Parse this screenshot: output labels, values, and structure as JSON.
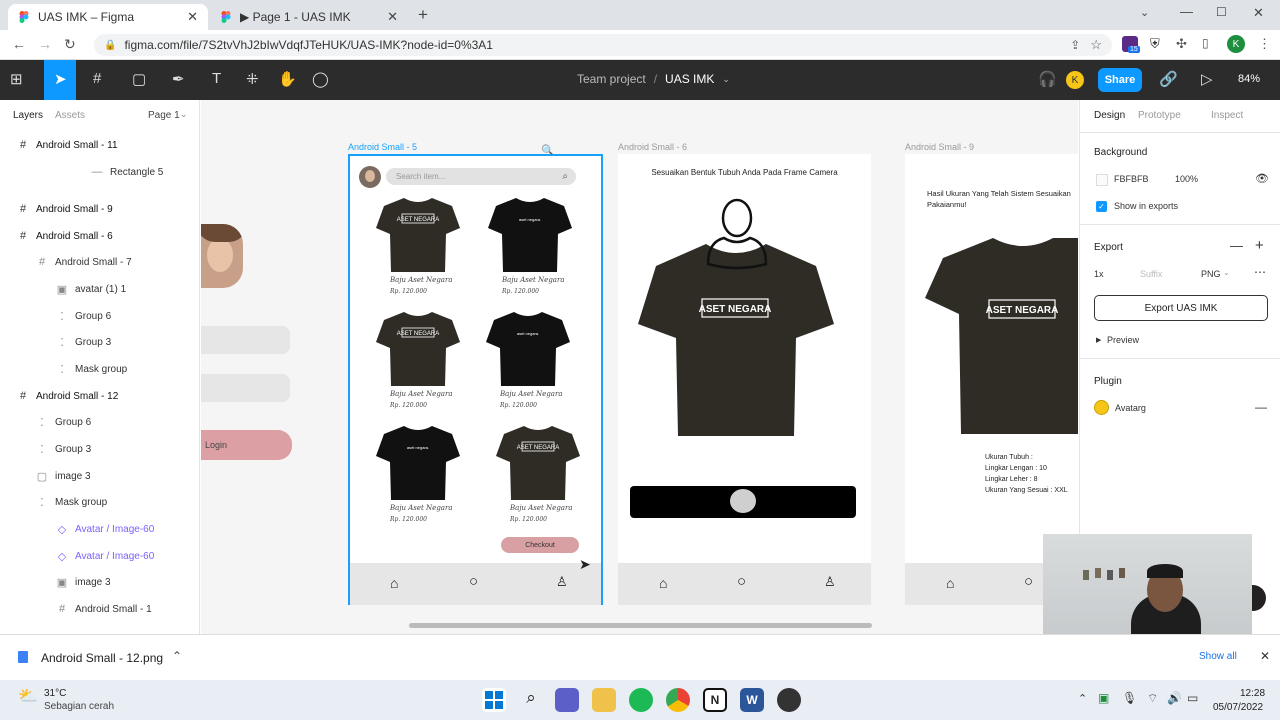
{
  "browser": {
    "tabs": [
      {
        "title": "UAS IMK – Figma",
        "active": true
      },
      {
        "title": "▶ Page 1 - UAS IMK",
        "active": false
      }
    ],
    "new_tab": "+",
    "url": "figma.com/file/7S2tvVhJ2bIwVdqfJTeHUK/UAS-IMK?node-id=0%3A1",
    "profile_initial": "K",
    "extension_badge": "15"
  },
  "figma": {
    "breadcrumb_team": "Team project",
    "breadcrumb_sep": "/",
    "file_name": "UAS IMK",
    "avatar_initial": "K",
    "share_label": "Share",
    "zoom": "84%"
  },
  "left_panel": {
    "tab_layers": "Layers",
    "tab_assets": "Assets",
    "page": "Page 1",
    "layers": [
      {
        "name": "Android Small - 11",
        "icon": "#"
      },
      {
        "name": "Rectangle 5",
        "icon": "—"
      },
      {
        "name": "Android Small - 9",
        "icon": "#"
      },
      {
        "name": "Android Small - 6",
        "icon": "#"
      },
      {
        "name": "Android Small - 7",
        "icon": "#"
      },
      {
        "name": "avatar (1) 1",
        "icon": "▣"
      },
      {
        "name": "Group 6",
        "icon": "⁚"
      },
      {
        "name": "Group 3",
        "icon": "⁚"
      },
      {
        "name": "Mask group",
        "icon": "⁚"
      },
      {
        "name": "Android Small - 12",
        "icon": "#"
      },
      {
        "name": "Group 6",
        "icon": "⁚"
      },
      {
        "name": "Group 3",
        "icon": "⁚"
      },
      {
        "name": "image 3",
        "icon": "▢"
      },
      {
        "name": "Mask group",
        "icon": "⁚"
      },
      {
        "name": "Avatar / Image-60",
        "icon": "◇"
      },
      {
        "name": "Avatar / Image-60",
        "icon": "◇"
      },
      {
        "name": "image 3",
        "icon": "▣"
      },
      {
        "name": "Android Small - 1",
        "icon": "#"
      }
    ]
  },
  "canvas": {
    "login_label": "Login",
    "frame5": {
      "label": "Android Small - 5",
      "search_placeholder": "Search item...",
      "products": [
        {
          "name": "Baju Aset Negara",
          "price": "Rp. 120.000",
          "print": "ASET NEGARA"
        },
        {
          "name": "Baju Aset Negara",
          "price": "Rp. 120.000",
          "print": "aset negara."
        },
        {
          "name": "Baju Aset Negara",
          "price": "Rp. 120.000",
          "print": "ASET NEGARA"
        },
        {
          "name": "Baju Aset Negara",
          "price": "Rp. 120.000",
          "print": "aset negara."
        },
        {
          "name": "Baju Aset Negara",
          "price": "Rp. 120.000",
          "print": "aset negara."
        },
        {
          "name": "Baju Aset Negara",
          "price": "Rp. 120.000",
          "print": "ASET NEGARA"
        }
      ],
      "checkout": "Checkout"
    },
    "frame6": {
      "label": "Android Small - 6",
      "instruction": "Sesuaikan Bentuk Tubuh Anda Pada Frame Camera",
      "print": "ASET NEGARA"
    },
    "frame9": {
      "label": "Android Small - 9",
      "result_title": "Hasil Ukuran Yang Telah Sistem Sesuaikan Pakaianmu!",
      "print": "ASET NEGARA",
      "size_lines": [
        "Ukuran Tubuh :",
        "Lingkar Lengan : 10",
        "Lingkar Leher : 8",
        "Ukuran Yang Sesuai : XXL"
      ]
    }
  },
  "right_panel": {
    "tabs": [
      "Design",
      "Prototype",
      "Inspect"
    ],
    "background_label": "Background",
    "bg_hex": "FBFBFB",
    "bg_opacity": "100%",
    "show_in_exports": "Show in exports",
    "export_label": "Export",
    "export_scale": "1x",
    "export_suffix_placeholder": "Suffix",
    "export_format": "PNG",
    "export_button": "Export UAS IMK",
    "preview": "Preview",
    "plugin_label": "Plugin",
    "plugin_name": "Avatarg"
  },
  "download_bar": {
    "file": "Android Small - 12.png",
    "show_all": "Show all"
  },
  "taskbar": {
    "weather_temp": "31°C",
    "weather_desc": "Sebagian cerah",
    "time": "12:28",
    "date": "05/07/2022"
  },
  "colors": {
    "figma_dark": "#2c2c2c",
    "share_blue": "#0d99ff",
    "selection": "#18a0fb",
    "checkout_pink": "#d9a0a4",
    "shirt_dark": "#2f2c26"
  }
}
